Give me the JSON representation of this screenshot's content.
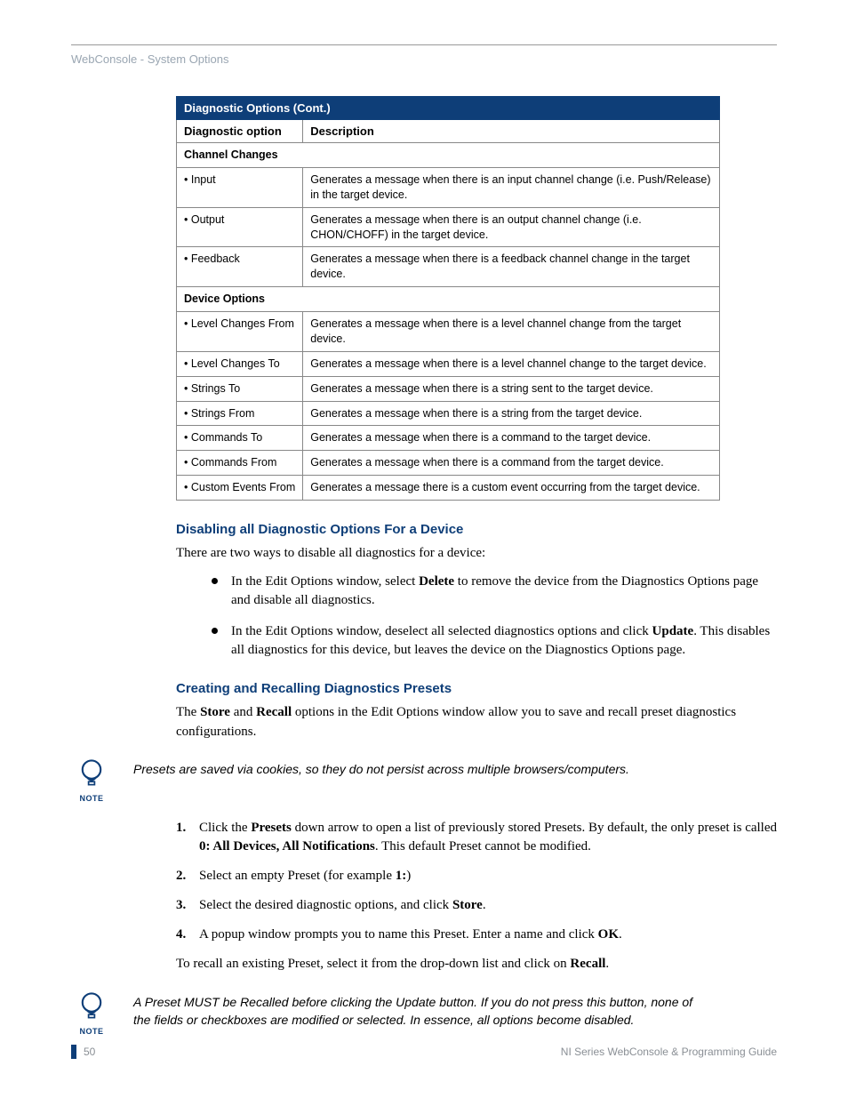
{
  "running_head": "WebConsole - System Options",
  "table": {
    "title": "Diagnostic Options (Cont.)",
    "col1": "Diagnostic option",
    "col2": "Description",
    "section1": "Channel Changes",
    "rows1": [
      {
        "opt": "•  Input",
        "desc": "Generates a message when there is an input channel change (i.e. Push/Release) in the target device."
      },
      {
        "opt": "•  Output",
        "desc": "Generates a message when there is an output channel change (i.e. CHON/CHOFF) in the target device."
      },
      {
        "opt": "•  Feedback",
        "desc": "Generates a message when there is a feedback channel change in the target device."
      }
    ],
    "section2": "Device Options",
    "rows2": [
      {
        "opt": "• Level Changes From",
        "desc": "Generates a message when there is a level channel change from the target device."
      },
      {
        "opt": "• Level Changes To",
        "desc": "Generates a message when there is a level channel change to the target device."
      },
      {
        "opt": "• Strings To",
        "desc": "Generates a message when there is a string sent to the target device."
      },
      {
        "opt": "• Strings From",
        "desc": "Generates a message when there is a string from the target device."
      },
      {
        "opt": "• Commands To",
        "desc": "Generates a message when there is a command to the target device."
      },
      {
        "opt": "• Commands From",
        "desc": "Generates a message when there is a command from the target device."
      },
      {
        "opt": "• Custom Events From",
        "desc": "Generates a message there is a custom event occurring from the target device."
      }
    ]
  },
  "h_disable": "Disabling all Diagnostic Options For a Device",
  "p_disable_intro": "There are two ways to disable all diagnostics for a device:",
  "bullet1_a": "In the Edit Options window, select ",
  "bullet1_b": "Delete",
  "bullet1_c": " to remove the device from the Diagnostics Options page and disable all diagnostics.",
  "bullet2_a": "In the Edit Options window, deselect all selected diagnostics options and click ",
  "bullet2_b": "Update",
  "bullet2_c": ". This disables all diagnostics for this device, but leaves the device on the Diagnostics Options page.",
  "h_presets": "Creating and Recalling Diagnostics Presets",
  "p_presets_a": "The ",
  "p_presets_b": "Store",
  "p_presets_c": " and ",
  "p_presets_d": "Recall",
  "p_presets_e": " options in the Edit Options window allow you to save and recall preset diagnostics configurations.",
  "note1": "Presets are saved via cookies, so they do not persist across multiple browsers/computers.",
  "note_label": "NOTE",
  "step1_a": "Click the ",
  "step1_b": "Presets",
  "step1_c": " down arrow to open a list of previously stored Presets. By default, the only preset is called ",
  "step1_d": "0: All Devices, All Notifications",
  "step1_e": ". This default Preset cannot be modified.",
  "step2_a": "Select an empty Preset (for example ",
  "step2_b": "1:",
  "step2_c": ")",
  "step3_a": "Select the desired diagnostic options, and click ",
  "step3_b": "Store",
  "step3_c": ".",
  "step4_a": "A popup window prompts you to name this Preset. Enter a name and click ",
  "step4_b": "OK",
  "step4_c": ".",
  "p_recall_a": "To recall an existing Preset, select it from the drop-down list and click on ",
  "p_recall_b": "Recall",
  "p_recall_c": ".",
  "note2": "A Preset MUST be Recalled before clicking the Update button. If you do not press this button, none of the fields or checkboxes are modified or selected. In essence, all options become disabled.",
  "footer_page": "50",
  "footer_title": "NI Series WebConsole & Programming Guide"
}
